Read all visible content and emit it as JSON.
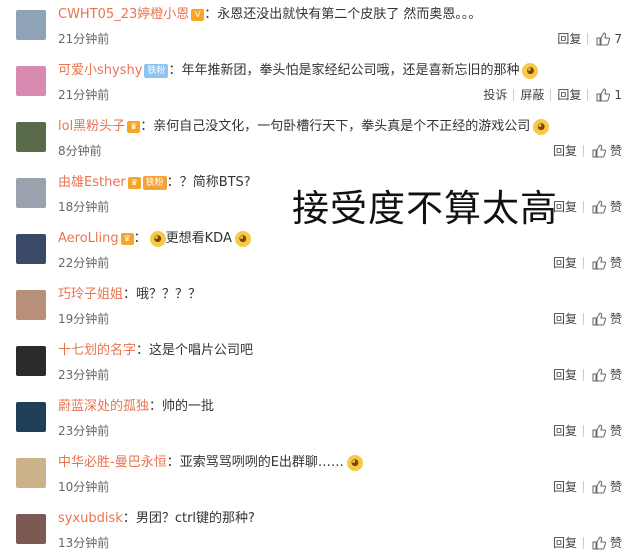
{
  "overlay_text": "接受度不算太高",
  "actions": {
    "reply": "回复",
    "report": "投诉",
    "block": "屏蔽"
  },
  "comments": [
    {
      "user": "CWHT05_23婷橙小恩",
      "text": "：永恩还没出就快有第二个皮肤了 然而奥恩。。。",
      "time": "21分钟前",
      "like": "7",
      "extra": false
    },
    {
      "user": "可爱小shyshy",
      "badge": "铁粉",
      "text": "：年年推新团，拳头怕是家经纪公司哦，还是喜新忘旧的那种",
      "time": "21分钟前",
      "like": "1",
      "extra": true
    },
    {
      "user": "lol黑粉头子",
      "text": "：亲何自己没文化，一句卧槽行天下，拳头真是个不正经的游戏公司",
      "time": "8分钟前",
      "like": "赞",
      "extra": false
    },
    {
      "user": "由雄Esther",
      "badge": "铁粉",
      "text": "：？简称BTS?",
      "time": "18分钟前",
      "like": "赞",
      "extra": false
    },
    {
      "user": "AeroLling",
      "text": "：",
      "text2": "更想看KDA",
      "time": "22分钟前",
      "like": "赞",
      "extra": false
    },
    {
      "user": "巧玲子姐姐",
      "text": "：哦？？？？",
      "time": "19分钟前",
      "like": "赞",
      "extra": false
    },
    {
      "user": "十七划的名字",
      "text": "：这是个唱片公司吧",
      "time": "23分钟前",
      "like": "赞",
      "extra": false
    },
    {
      "user": "蔚蓝深处的孤独",
      "text": "：帅的一批",
      "time": "23分钟前",
      "like": "赞",
      "extra": false
    },
    {
      "user": "中华必胜-曼巴永恒",
      "text": "：亚索骂骂咧咧的E出群聊……",
      "time": "10分钟前",
      "like": "赞",
      "extra": false
    },
    {
      "user": "syxubdisk",
      "text": "：男团？ctrl键的那种?",
      "time": "13分钟前",
      "like": "赞",
      "extra": false
    }
  ],
  "avatar_colors": [
    "#8fa3b8",
    "#d98ab0",
    "#5a6b4a",
    "#9aa3ad",
    "#3a4a66",
    "#b88f7a",
    "#2a2a2a",
    "#1e3f5a",
    "#cbb28a",
    "#7a5a52"
  ]
}
